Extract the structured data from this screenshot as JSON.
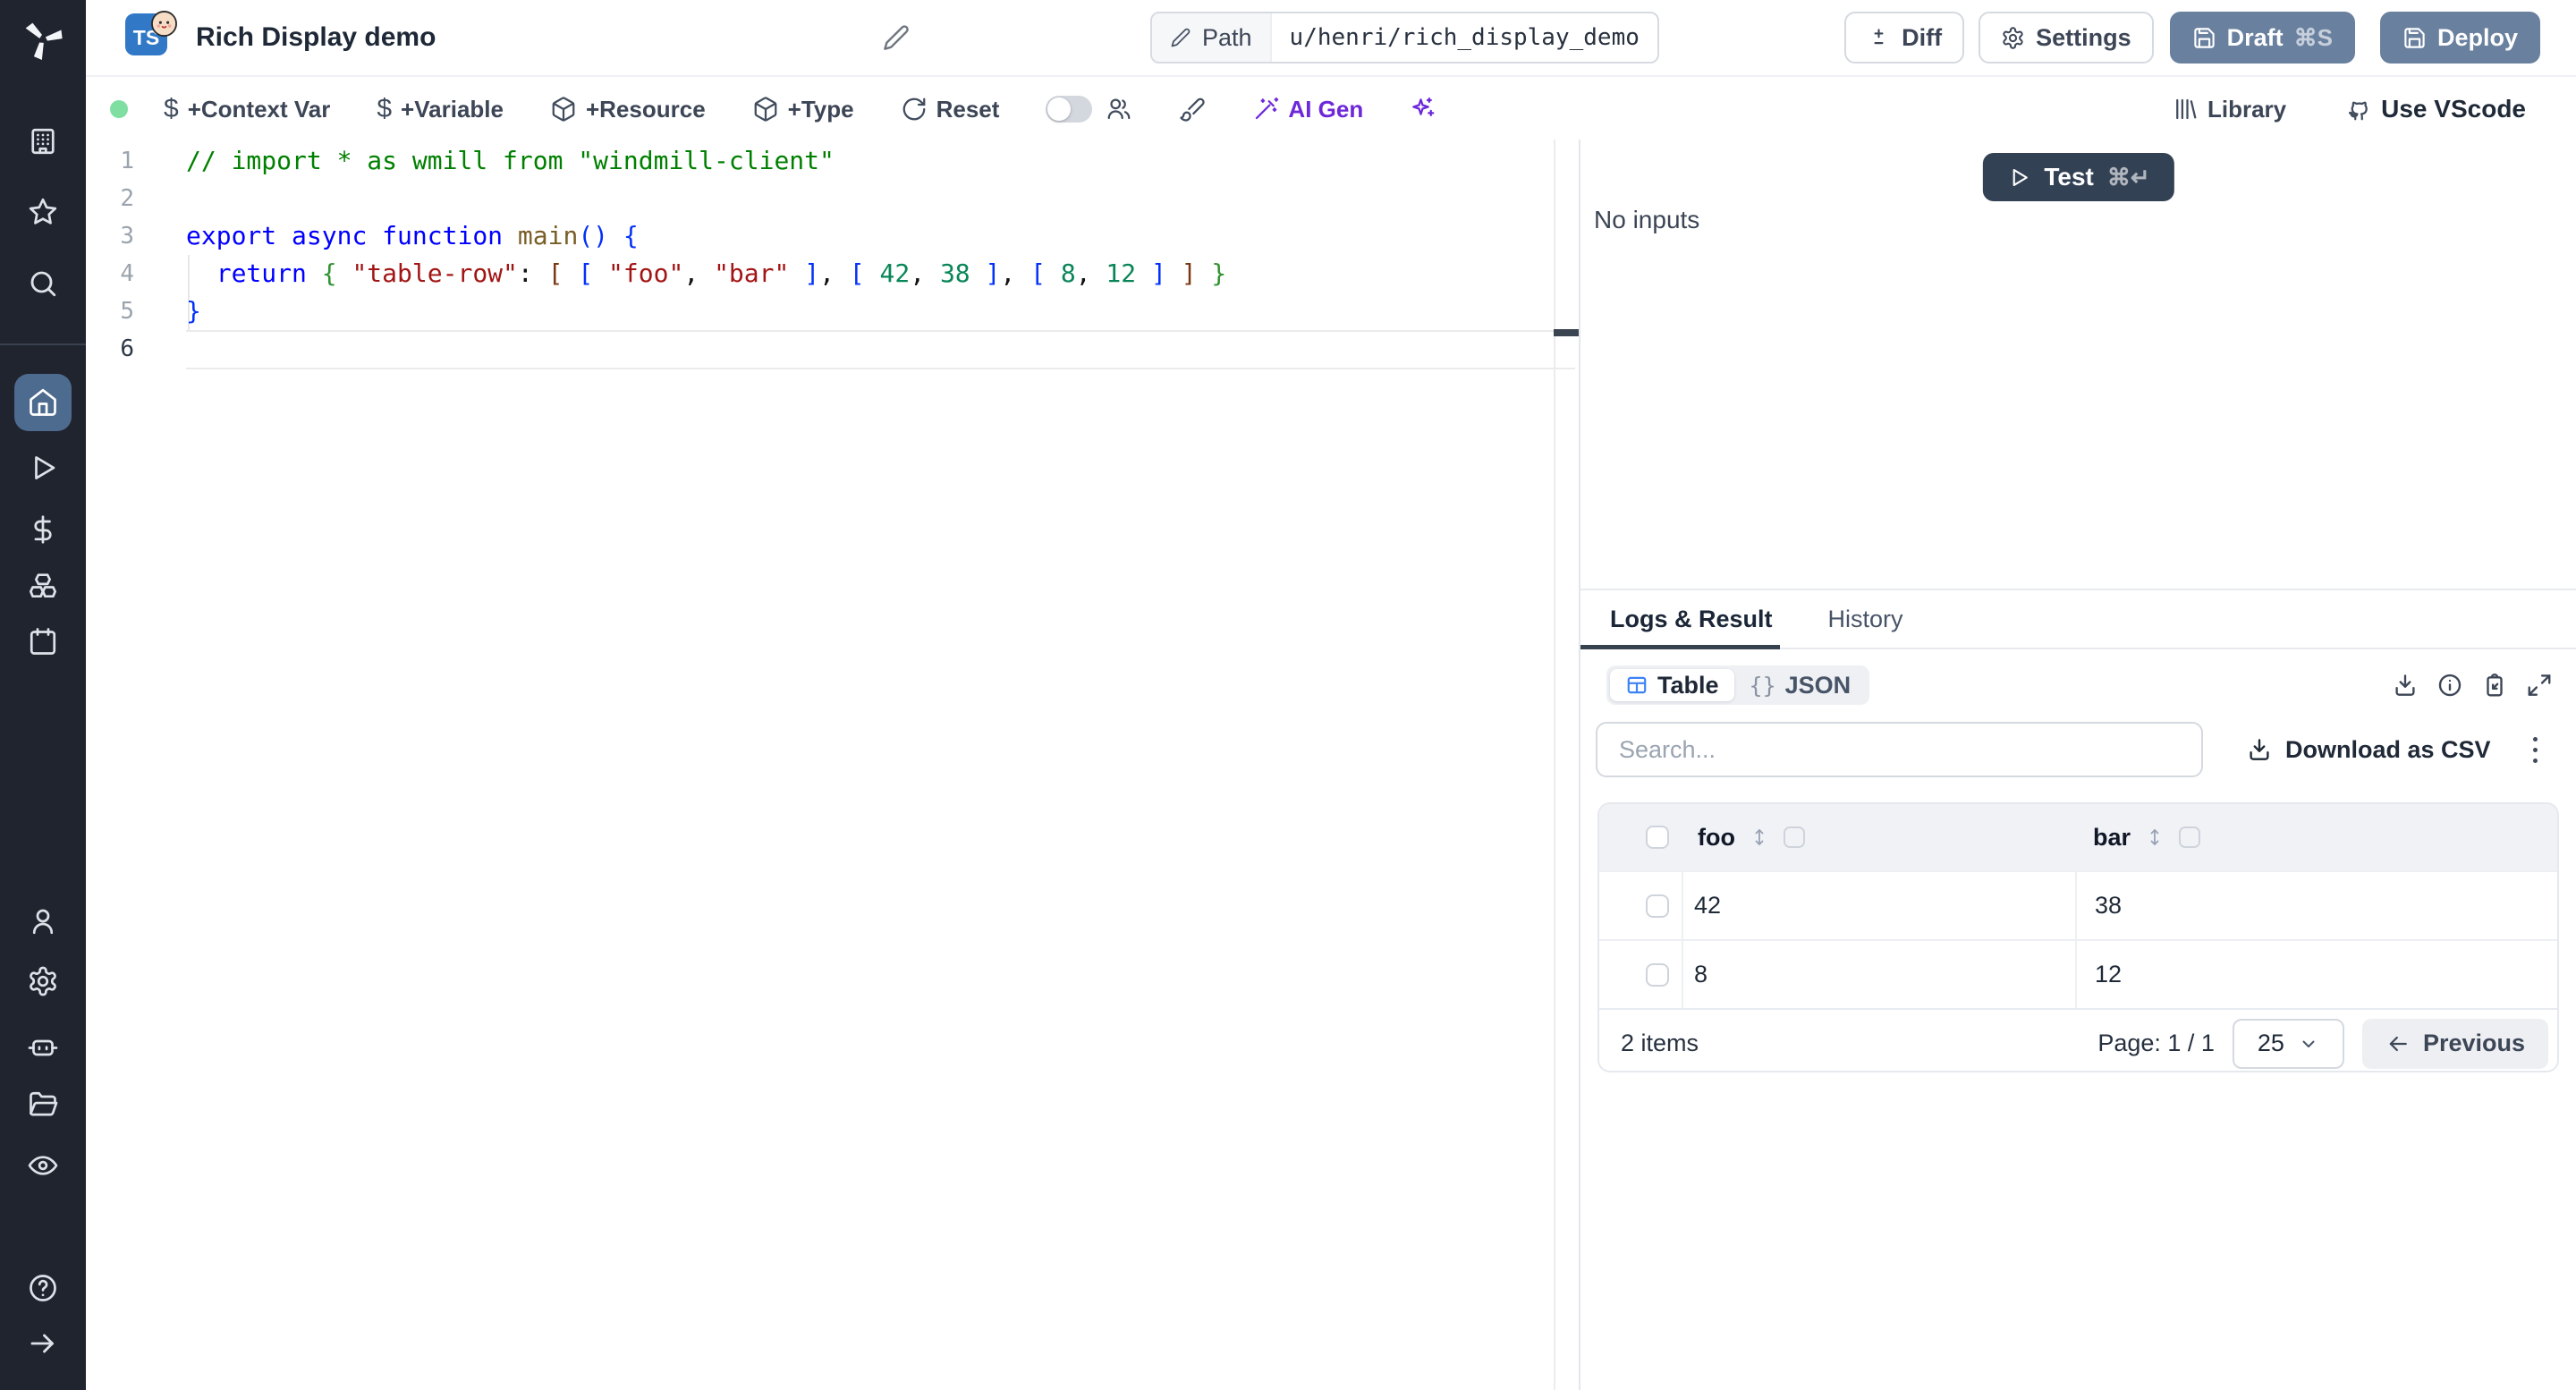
{
  "header": {
    "app_badge": "TS",
    "title": "Rich Display demo",
    "path_label": "Path",
    "path_value": "u/henri/rich_display_demo",
    "diff_label": "Diff",
    "settings_label": "Settings",
    "draft_label": "Draft",
    "draft_shortcut": "⌘S",
    "deploy_label": "Deploy"
  },
  "toolbar": {
    "context_var_label": "+Context Var",
    "variable_label": "+Variable",
    "resource_label": "+Resource",
    "type_label": "+Type",
    "reset_label": "Reset",
    "ai_gen_label": "AI Gen",
    "library_label": "Library",
    "vscode_label": "Use VScode"
  },
  "editor": {
    "active_line": 6,
    "lines": [
      [
        {
          "t": "// import * as wmill from \"windmill-client\"",
          "c": "cm"
        }
      ],
      [],
      [
        {
          "t": "export",
          "c": "kw"
        },
        {
          "t": " ",
          "c": "pl"
        },
        {
          "t": "async",
          "c": "kw"
        },
        {
          "t": " ",
          "c": "pl"
        },
        {
          "t": "function",
          "c": "kw"
        },
        {
          "t": " ",
          "c": "pl"
        },
        {
          "t": "main",
          "c": "fn"
        },
        {
          "t": "()",
          "c": "b1"
        },
        {
          "t": " ",
          "c": "pl"
        },
        {
          "t": "{",
          "c": "b1"
        }
      ],
      [
        {
          "t": "  ",
          "c": "pl"
        },
        {
          "t": "return",
          "c": "kw"
        },
        {
          "t": " ",
          "c": "pl"
        },
        {
          "t": "{",
          "c": "b2"
        },
        {
          "t": " ",
          "c": "pl"
        },
        {
          "t": "\"table-row\"",
          "c": "str"
        },
        {
          "t": ": ",
          "c": "pl"
        },
        {
          "t": "[",
          "c": "b3"
        },
        {
          "t": " ",
          "c": "pl"
        },
        {
          "t": "[",
          "c": "b1"
        },
        {
          "t": " ",
          "c": "pl"
        },
        {
          "t": "\"foo\"",
          "c": "str"
        },
        {
          "t": ", ",
          "c": "pl"
        },
        {
          "t": "\"bar\"",
          "c": "str"
        },
        {
          "t": " ",
          "c": "pl"
        },
        {
          "t": "]",
          "c": "b1"
        },
        {
          "t": ", ",
          "c": "pl"
        },
        {
          "t": "[",
          "c": "b1"
        },
        {
          "t": " ",
          "c": "pl"
        },
        {
          "t": "42",
          "c": "num"
        },
        {
          "t": ", ",
          "c": "pl"
        },
        {
          "t": "38",
          "c": "num"
        },
        {
          "t": " ",
          "c": "pl"
        },
        {
          "t": "]",
          "c": "b1"
        },
        {
          "t": ", ",
          "c": "pl"
        },
        {
          "t": "[",
          "c": "b1"
        },
        {
          "t": " ",
          "c": "pl"
        },
        {
          "t": "8",
          "c": "num"
        },
        {
          "t": ", ",
          "c": "pl"
        },
        {
          "t": "12",
          "c": "num"
        },
        {
          "t": " ",
          "c": "pl"
        },
        {
          "t": "]",
          "c": "b1"
        },
        {
          "t": " ",
          "c": "pl"
        },
        {
          "t": "]",
          "c": "b3"
        },
        {
          "t": " ",
          "c": "pl"
        },
        {
          "t": "}",
          "c": "b2"
        }
      ],
      [
        {
          "t": "}",
          "c": "b1"
        }
      ],
      []
    ]
  },
  "run_panel": {
    "test_label": "Test",
    "test_shortcut": "⌘↵",
    "no_inputs": "No inputs"
  },
  "result_panel": {
    "tabs": [
      {
        "label": "Logs & Result",
        "active": true
      },
      {
        "label": "History",
        "active": false
      }
    ],
    "view_toggle": [
      {
        "label": "Table",
        "active": true
      },
      {
        "label": "JSON",
        "active": false
      }
    ],
    "json_glyph": "{}",
    "search_placeholder": "Search...",
    "download_csv_label": "Download as CSV",
    "table": {
      "columns": [
        "foo",
        "bar"
      ],
      "rows": [
        [
          "42",
          "38"
        ],
        [
          "8",
          "12"
        ]
      ],
      "items_label": "2 items",
      "page_label": "Page: 1 / 1",
      "page_size": "25",
      "previous_label": "Previous"
    }
  },
  "sidebar_icons": [
    "windmill-logo",
    "building",
    "star",
    "search",
    "home",
    "play",
    "dollar",
    "boxes",
    "calendar",
    "user",
    "gear",
    "bot",
    "folder",
    "eye",
    "help-circle",
    "arrow-right"
  ],
  "colors": {
    "slate-button": "#69809f",
    "test-button": "#334155",
    "accent-purple": "#6d28d9",
    "status-green": "#7fdfa2",
    "typescript-blue": "#3178c6",
    "table-icon-blue": "#3b82f6",
    "sidebar-active": "#4d6a8f"
  }
}
